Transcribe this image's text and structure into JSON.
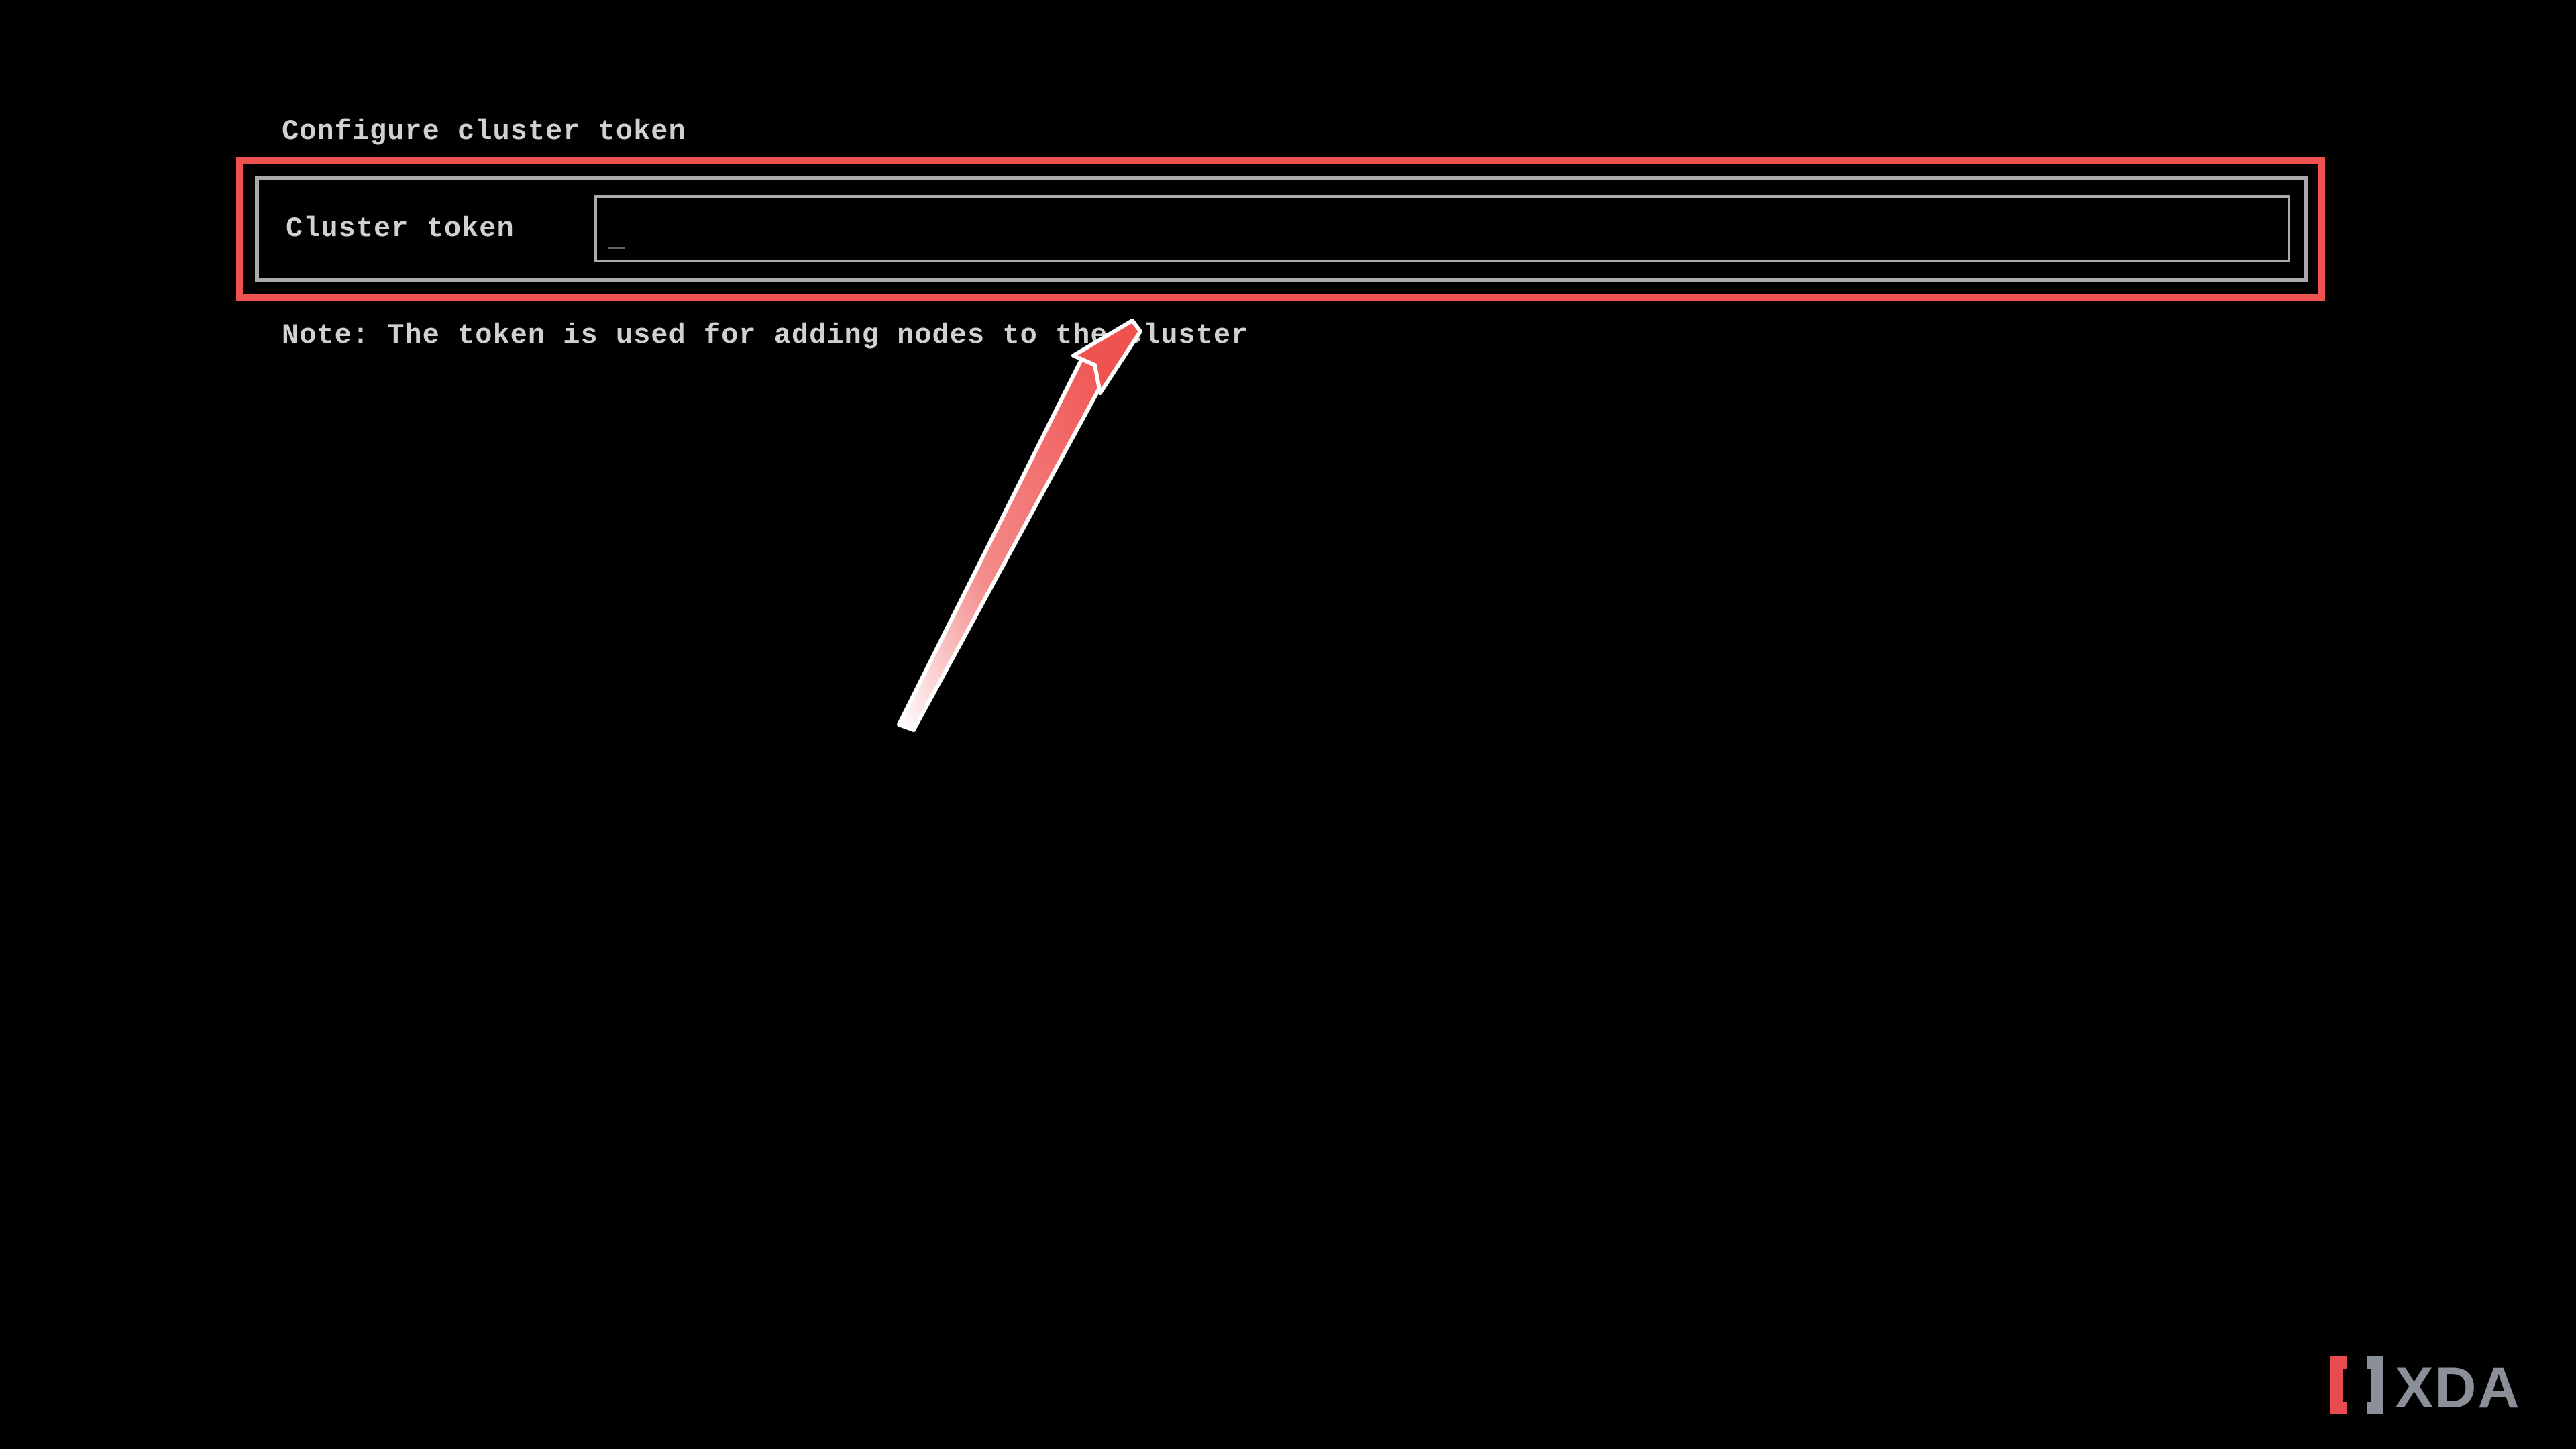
{
  "title": "Configure cluster token",
  "form": {
    "field_label": "Cluster token",
    "field_value": "",
    "cursor": "_"
  },
  "note": "Note: The token is used for adding nodes to the cluster",
  "annotation": {
    "highlight_color": "#ef5350",
    "arrow_color_fill": "#ef5350",
    "arrow_color_stroke": "#ffffff"
  },
  "watermark": {
    "text": "XDA",
    "bracket_left_color": "#e84c50",
    "bracket_right_color": "#8a8f98",
    "text_color": "#8a8f98"
  }
}
